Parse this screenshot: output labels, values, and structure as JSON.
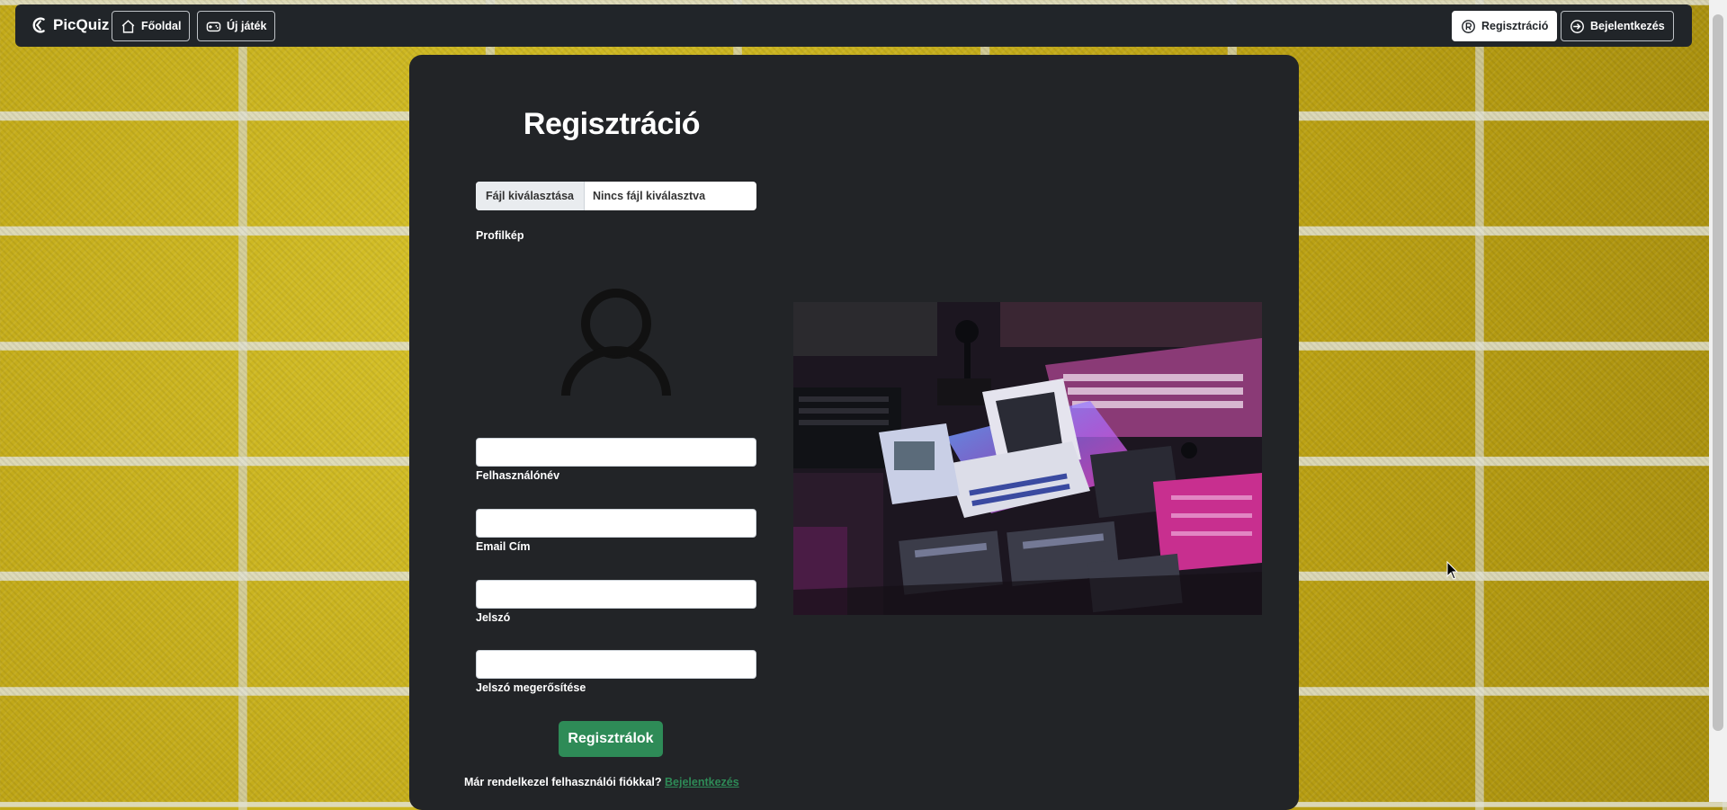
{
  "navbar": {
    "brand": "PicQuiz",
    "home_label": "Főoldal",
    "new_game_label": "Új játék",
    "register_label": "Regisztráció",
    "login_label": "Bejelentkezés"
  },
  "form": {
    "title": "Regisztráció",
    "file_button": "Fájl kiválasztása",
    "file_status": "Nincs fájl kiválasztva",
    "profile_label": "Profilkép",
    "username_label": "Felhasználónév",
    "email_label": "Email Cím",
    "password_label": "Jelszó",
    "password_confirm_label": "Jelszó megerősítése",
    "submit_label": "Regisztrálok",
    "already_text": "Már rendelkezel felhasználói fiókkal?",
    "login_link": "Bejelentkezés"
  },
  "colors": {
    "navbar_bg": "#212529",
    "card_bg": "#222427",
    "accent_green": "#2e8b57",
    "wall_yellow": "#c9b21a"
  }
}
